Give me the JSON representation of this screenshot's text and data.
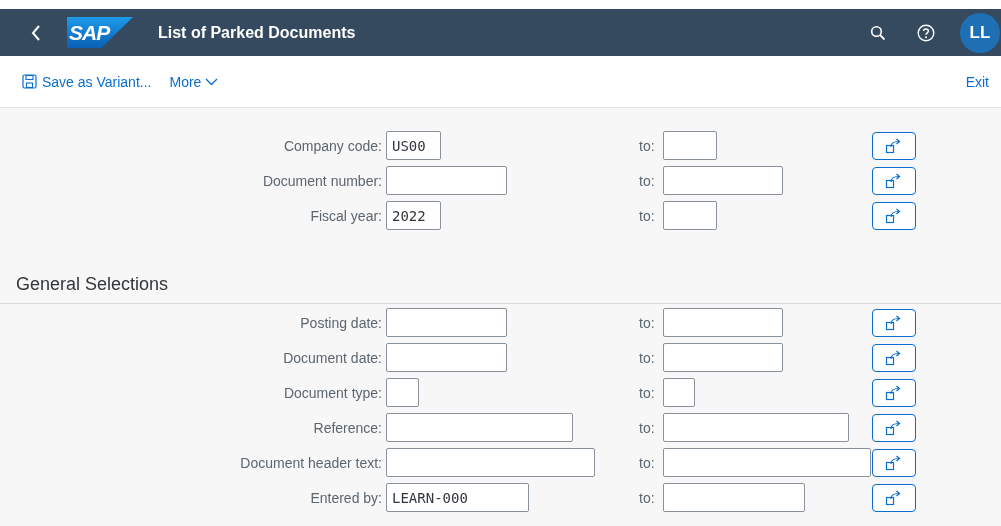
{
  "shell": {
    "logo": "SAP",
    "title": "List of Parked Documents",
    "avatar": "LL"
  },
  "toolbar": {
    "actions": [
      {
        "label": "Save as Variant...",
        "kind": "save"
      },
      {
        "label": "More",
        "kind": "menu"
      }
    ],
    "exit": "Exit"
  },
  "sections": [
    {
      "rows": [
        {
          "label": "Company code:",
          "value": "US00",
          "kind": "short",
          "to_label": "to:"
        },
        {
          "label": "Document number:",
          "kind": "medium",
          "to_label": "to:"
        },
        {
          "label": "Fiscal year:",
          "value": "2022",
          "kind": "short",
          "to_label": "to:"
        }
      ]
    },
    {
      "title": "General Selections",
      "rows": [
        {
          "label": "Posting date:",
          "kind": "medium",
          "to_label": "to:"
        },
        {
          "label": "Document date:",
          "kind": "medium",
          "to_label": "to:"
        },
        {
          "label": "Document type:",
          "kind": "tiny",
          "to_label": "to:"
        },
        {
          "label": "Reference:",
          "kind": "long",
          "to_label": "to:"
        },
        {
          "label": "Document header text:",
          "kind": "wide",
          "to_label": "to:"
        },
        {
          "label": "Entered by:",
          "value": "LEARN-000",
          "kind": "user",
          "to_label": "to:"
        }
      ]
    }
  ]
}
